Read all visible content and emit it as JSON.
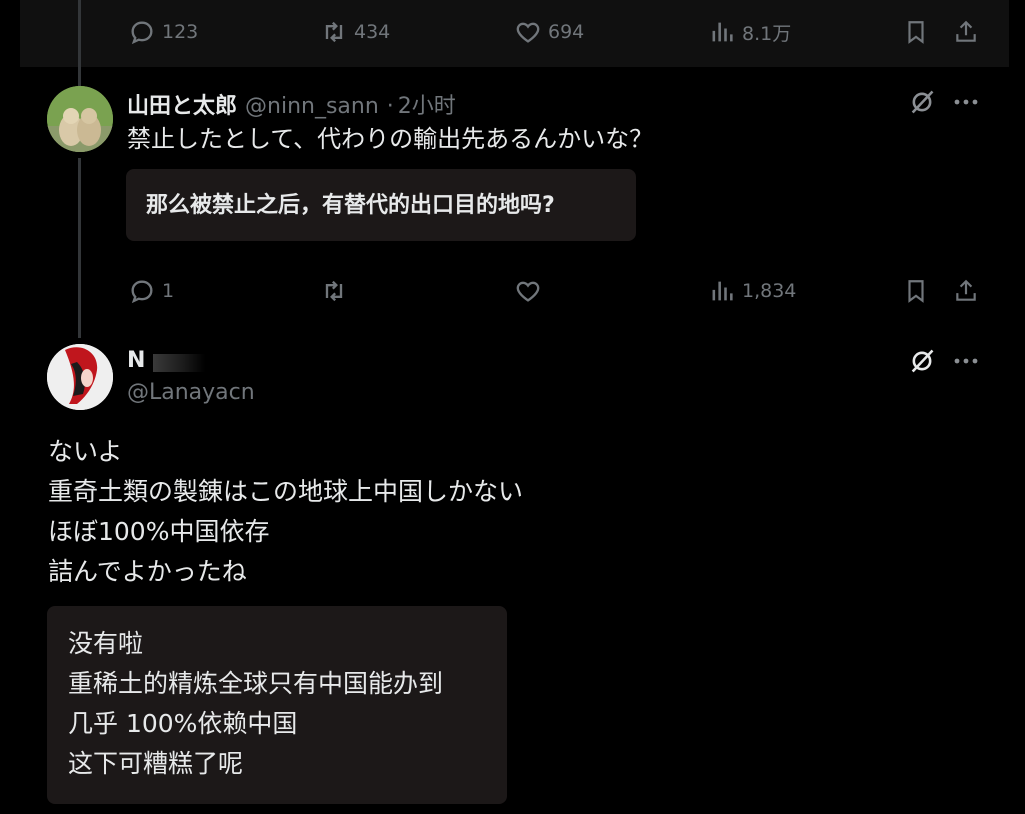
{
  "prev_tweet": {
    "replies": "123",
    "retweets": "434",
    "likes": "694",
    "views": "8.1万"
  },
  "reply1": {
    "name": "山田と太郎",
    "handle": "@ninn_sann",
    "sep": "·",
    "time": "2小时",
    "text": "禁止したとして、代わりの輸出先あるんかいな？",
    "translation": "那么被禁止之后，有替代的出口目的地吗?",
    "replies": "1",
    "views": "1,834"
  },
  "reply2": {
    "name": "N",
    "handle": "@Lanayacn",
    "text_lines": [
      "ないよ",
      "重奇土類の製錬はこの地球上中国しかない",
      "ほぼ100%中国依存",
      "詰んでよかったね"
    ],
    "translation_lines": [
      "没有啦",
      "重稀土的精炼全球只有中国能办到",
      "几乎 100%依赖中国",
      "这下可糟糕了呢"
    ]
  },
  "icons": {
    "reply": "reply-icon",
    "retweet": "retweet-icon",
    "like": "heart-icon",
    "views": "views-icon",
    "bookmark": "bookmark-icon",
    "share": "share-icon",
    "grok": "grok-icon",
    "more": "more-icon"
  },
  "colors": {
    "background": "#000000",
    "text": "#e7e9ea",
    "muted": "#71767b",
    "translation_box": "#1c1818"
  }
}
